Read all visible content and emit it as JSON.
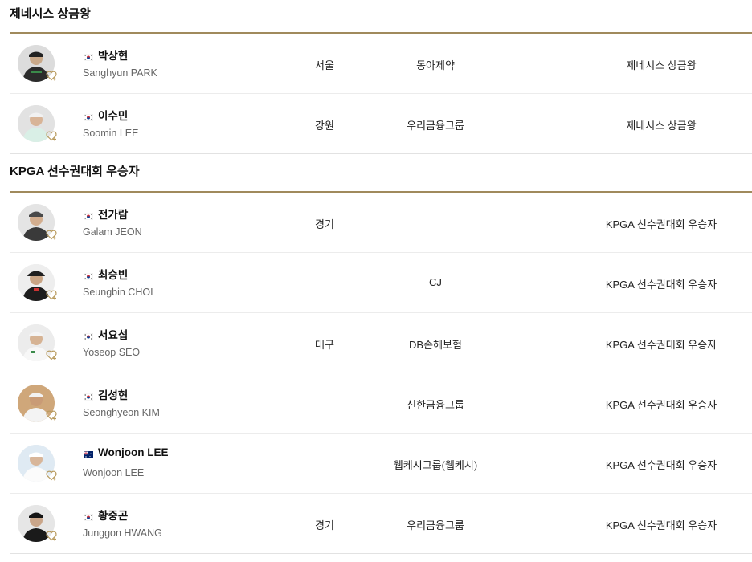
{
  "sections": [
    {
      "title": "제네시스 상금왕",
      "rows": [
        {
          "name_ko": "박상현",
          "name_en": "Sanghyun PARK",
          "flag": "korea",
          "region": "서울",
          "sponsor": "동아제약",
          "award": "제네시스 상금왕"
        },
        {
          "name_ko": "이수민",
          "name_en": "Soomin LEE",
          "flag": "korea",
          "region": "강원",
          "sponsor": "우리금융그룹",
          "award": "제네시스 상금왕"
        }
      ]
    },
    {
      "title": "KPGA 선수권대회 우승자",
      "rows": [
        {
          "name_ko": "전가람",
          "name_en": "Galam JEON",
          "flag": "korea",
          "region": "경기",
          "sponsor": "",
          "award": "KPGA 선수권대회 우승자"
        },
        {
          "name_ko": "최승빈",
          "name_en": "Seungbin CHOI",
          "flag": "korea",
          "region": "",
          "sponsor": "CJ",
          "award": "KPGA 선수권대회 우승자"
        },
        {
          "name_ko": "서요섭",
          "name_en": "Yoseop SEO",
          "flag": "korea",
          "region": "대구",
          "sponsor": "DB손해보험",
          "award": "KPGA 선수권대회 우승자"
        },
        {
          "name_ko": "김성현",
          "name_en": "Seonghyeon KIM",
          "flag": "korea",
          "region": "",
          "sponsor": "신한금융그룹",
          "award": "KPGA 선수권대회 우승자"
        },
        {
          "name_ko": "Wonjoon LEE",
          "name_en": "Wonjoon LEE",
          "flag": "australia",
          "region": "",
          "sponsor": "웹케시그룹(웹케시)",
          "award": "KPGA 선수권대회 우승자"
        },
        {
          "name_ko": "황중곤",
          "name_en": "Junggon HWANG",
          "flag": "korea",
          "region": "경기",
          "sponsor": "우리금융그룹",
          "award": "KPGA 선수권대회 우승자"
        }
      ]
    }
  ],
  "colors": {
    "accent_rule": "#a08a5c",
    "favorite_icon": "#b89b5e"
  },
  "icons": {
    "favorite": "heart-plus-icon",
    "avatar": "player-photo"
  }
}
